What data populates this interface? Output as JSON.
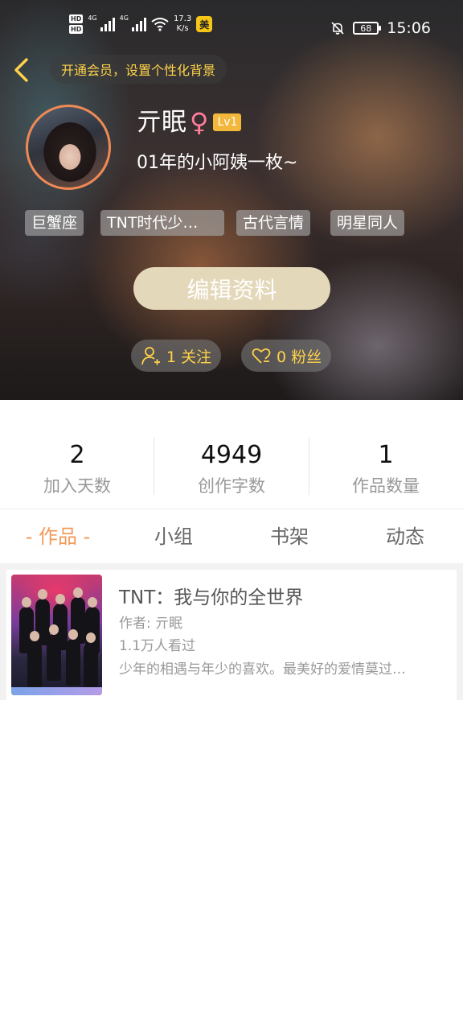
{
  "status_bar": {
    "hd1": "HD",
    "hd2": "HD",
    "net1": "4G",
    "net2": "4G",
    "speed_value": "17.3",
    "speed_unit": "K/s",
    "app_badge": "美",
    "battery": "68",
    "time": "15:06"
  },
  "header": {
    "vip_prompt": "开通会员，设置个性化背景",
    "username": "亓眠",
    "gender_symbol": "♀",
    "level": "Lv1",
    "bio": "01年的小阿姨一枚~",
    "tags": [
      "巨蟹座",
      "TNT时代少…",
      "古代言情",
      "明星同人"
    ],
    "edit_button": "编辑资料",
    "following": "1 关注",
    "followers": "0 粉丝"
  },
  "stats": [
    {
      "value": "2",
      "label": "加入天数"
    },
    {
      "value": "4949",
      "label": "创作字数"
    },
    {
      "value": "1",
      "label": "作品数量"
    }
  ],
  "tabs": [
    "- 作品 -",
    "小组",
    "书架",
    "动态"
  ],
  "works": [
    {
      "title": "TNT：我与你的全世界",
      "author": "作者: 亓眠",
      "views": "1.1万人看过",
      "description": "少年的相遇与年少的喜欢。最美好的爱情莫过…"
    }
  ],
  "colors": {
    "accent_orange": "#f09a5a",
    "vip_yellow": "#ffd24a",
    "edit_button_bg": "#e4d8ba",
    "level_badge": "#f3b73b",
    "female_pink": "#ff7d9a"
  }
}
